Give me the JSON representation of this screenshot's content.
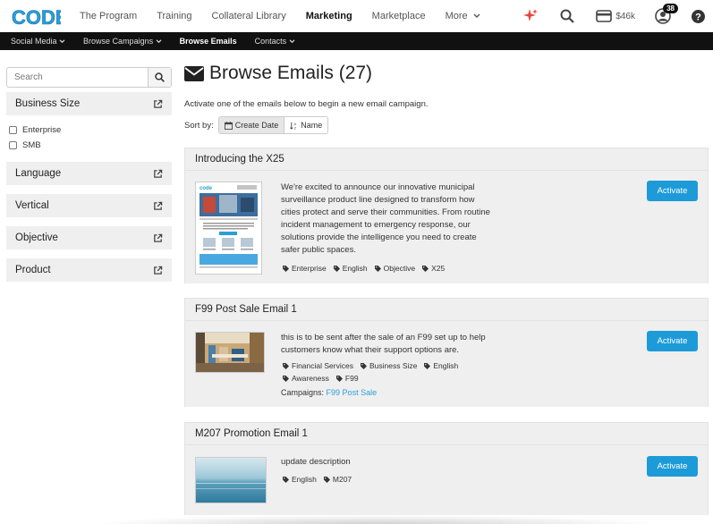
{
  "topnav": {
    "logo_text": "CODE",
    "links": [
      {
        "label": "The Program"
      },
      {
        "label": "Training"
      },
      {
        "label": "Collateral Library"
      },
      {
        "label": "Marketing"
      },
      {
        "label": "Marketplace"
      },
      {
        "label": "More"
      }
    ],
    "wallet_amount": "$46k",
    "notifications_count": "38",
    "icons": [
      "sparkle-icon",
      "search-icon",
      "wallet-icon",
      "user-icon",
      "help-icon"
    ]
  },
  "subnav": {
    "items": [
      {
        "label": "Social Media"
      },
      {
        "label": "Browse Campaigns"
      },
      {
        "label": "Browse Emails"
      },
      {
        "label": "Contacts"
      }
    ]
  },
  "sidebar": {
    "search_placeholder": "Search",
    "filters": [
      {
        "label": "Business Size",
        "options": [
          "Enterprise",
          "SMB"
        ]
      },
      {
        "label": "Language"
      },
      {
        "label": "Vertical"
      },
      {
        "label": "Objective"
      },
      {
        "label": "Product"
      }
    ]
  },
  "main": {
    "title": "Browse Emails (27)",
    "intro": "Activate one of the emails below to begin a new email campaign.",
    "sort_label": "Sort by:",
    "sort_options": [
      "Create Date",
      "Name"
    ],
    "activate_label": "Activate",
    "campaigns_label": "Campaigns:",
    "cards": [
      {
        "title": "Introducing the X25",
        "description_lines": [
          "We're excited to announce our innovative municipal",
          "surveillance product line designed to transform how",
          "cities protect and serve their communities. From routine",
          "incident management to emergency response, our",
          "solutions provide the intelligence you need to create",
          "safer public spaces."
        ],
        "tags": [
          "Enterprise",
          "English",
          "Objective",
          "X25"
        ]
      },
      {
        "title": "F99 Post Sale Email 1",
        "description_lines": [
          "this is to be sent after the sale of an F99 set up to help",
          "customers know what their support options are."
        ],
        "tags": [
          "Financial Services",
          "Business Size",
          "English",
          "Awareness",
          "F99"
        ],
        "campaign": "F99 Post Sale"
      },
      {
        "title": "M207 Promotion Email 1",
        "description_lines": [
          "update description"
        ],
        "tags": [
          "English",
          "M207"
        ]
      }
    ]
  },
  "colors": {
    "accent": "#1d9bd8",
    "subnav_bg": "#111111",
    "card_bg": "#efefef",
    "sparkle": "#e8423c"
  }
}
